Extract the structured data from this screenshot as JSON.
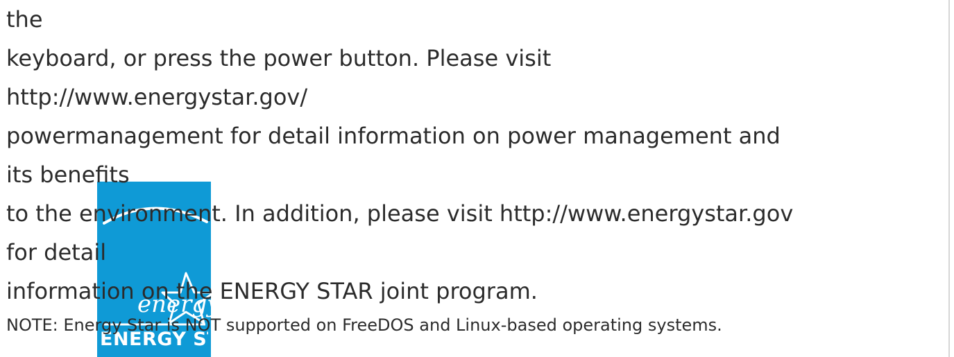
{
  "document": {
    "lines": [
      "the",
      "keyboard, or press the power button. Please visit",
      "http://www.energystar.gov/",
      "powermanagement for detail information on power management and",
      "its benefits",
      "to the environment. In addition, please visit http://www.energystar.gov",
      "for detail",
      "information on the ENERGY STAR joint program."
    ],
    "note": "NOTE: Energy Star is NOT supported on FreeDOS and Linux-based operating systems."
  },
  "logo": {
    "script_text": "energy",
    "wordmark": "ENERGY STAR",
    "background_color": "#0f9ad6",
    "foreground_color": "#ffffff"
  }
}
